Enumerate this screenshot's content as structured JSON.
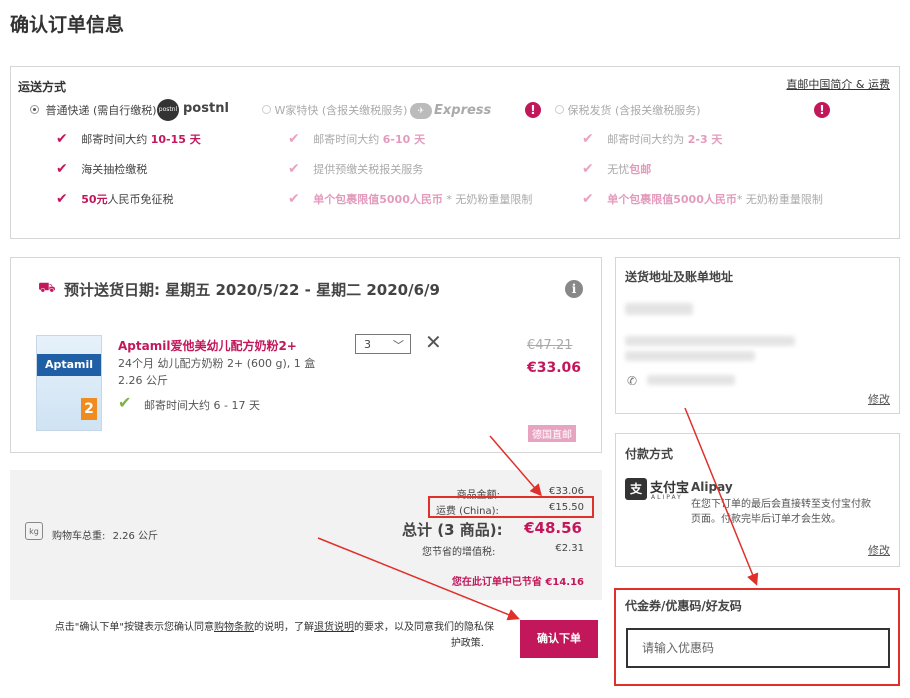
{
  "page": {
    "title": "确认订单信息"
  },
  "shipping": {
    "title": "运送方式",
    "link": "直邮中国简介 & 运费",
    "options": [
      {
        "label": "普通快递 (需自行缴税)",
        "brand_badge": "postnl",
        "brand": "postnl",
        "selected": true,
        "features": [
          {
            "pre": "邮寄时间大约 ",
            "hl": "10-15 天",
            "post": ""
          },
          {
            "pre": "海关抽检缴税",
            "hl": "",
            "post": ""
          },
          {
            "pre": "",
            "hl": "50元",
            "post": "人民币免征税"
          }
        ]
      },
      {
        "label": "W家特快 (含报关缴税服务)",
        "brand": "Express",
        "selected": false,
        "features": [
          {
            "pre": "邮寄时间大约 ",
            "hl": "6-10 天",
            "post": ""
          },
          {
            "pre": "提供预缴关税报关服务",
            "hl": "",
            "post": ""
          },
          {
            "pre": "",
            "hl": "单个包裹限值5000人民币",
            "post": " * 无奶粉重量限制"
          }
        ]
      },
      {
        "label": "保税发货 (含报关缴税服务)",
        "selected": false,
        "features": [
          {
            "pre": "邮寄时间大约为 ",
            "hl": "2-3 天",
            "post": ""
          },
          {
            "pre": "无忧",
            "hl": "包邮",
            "post": ""
          },
          {
            "pre": "",
            "hl": "单个包裹限值5000人民币",
            "post": "* 无奶粉重量限制"
          }
        ]
      }
    ],
    "warn_glyph": "!"
  },
  "delivery": {
    "text": "预计送货日期: 星期五 2020/5/22 - 星期二 2020/6/9",
    "info_glyph": "i"
  },
  "product": {
    "thumb_brand": "Aptamil",
    "thumb_stage": "2",
    "name": "Aptamil爱他美幼儿配方奶粉2+",
    "desc": "24个月 幼儿配方奶粉 2+ (600 g), 1 盒",
    "weight": "2.26 公斤",
    "delivery_time": "邮寄时间大约 6 - 17 天",
    "qty": "3",
    "old_price": "€47.21",
    "new_price": "€33.06",
    "tag": "德国直邮"
  },
  "summary": {
    "cart_weight_label": "购物车总重:",
    "cart_weight": "2.26 公斤",
    "kg_icon": "kg",
    "subtotal_label": "商品金额:",
    "subtotal": "€33.06",
    "shipping_label": "运费 (China):",
    "shipping": "€15.50",
    "total_label": "总计 (3 商品):",
    "total": "€48.56",
    "vat_label": "您节省的增值税:",
    "vat": "€2.31",
    "savings": "您在此订单中已节省 €14.16"
  },
  "notice": {
    "p1": "点击\"确认下单\"按键表示您确认同意",
    "link1": "购物条款",
    "p2": "的说明，了解",
    "link2": "退货说明",
    "p3": "的要求，以及同意我们的隐私保",
    "p4": "护政策."
  },
  "confirm_button": "确认下单",
  "address": {
    "title": "送货地址及账单地址",
    "edit": "修改",
    "phone_icon": "✆"
  },
  "payment": {
    "title": "付款方式",
    "alipay_mark": "支",
    "alipay_cn": "支付宝",
    "alipay_en": "ALIPAY",
    "name": "Alipay",
    "desc_1": "在您下订单的最后会直接转至支付宝付款",
    "desc_2": "页面。付款完毕后订单才会生效。",
    "edit": "修改"
  },
  "coupon": {
    "title": "代金券/优惠码/好友码",
    "placeholder": "请输入优惠码"
  },
  "colors": {
    "accent": "#c2185b",
    "annotation": "#e0302a"
  }
}
